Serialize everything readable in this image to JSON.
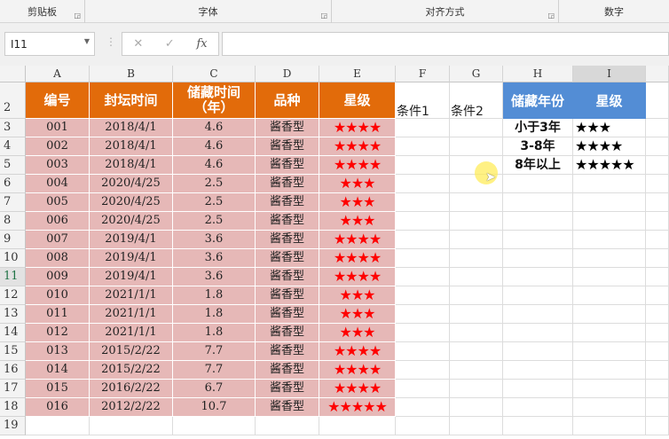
{
  "ribbon": {
    "groups": [
      "剪贴板",
      "字体",
      "对齐方式",
      "数字"
    ]
  },
  "formula_bar": {
    "name_box": "I11",
    "cancel": "✕",
    "enter": "✓",
    "fx": "fx",
    "value": ""
  },
  "columns": [
    "A",
    "B",
    "C",
    "D",
    "E",
    "F",
    "G",
    "H",
    "I"
  ],
  "rows": [
    "2",
    "3",
    "4",
    "5",
    "6",
    "7",
    "8",
    "9",
    "10",
    "11",
    "12",
    "13",
    "14",
    "15",
    "16",
    "17",
    "18",
    "19"
  ],
  "selected_row": "11",
  "headers": {
    "a": "编号",
    "b": "封坛时间",
    "c": "储藏时间",
    "c2": "（年）",
    "d": "品种",
    "e": "星级",
    "f": "条件1",
    "g": "条件2",
    "h": "储藏年份",
    "i": "星级"
  },
  "table": [
    [
      "001",
      "2018/4/1",
      "4.6",
      "酱香型",
      "★★★★"
    ],
    [
      "002",
      "2018/4/1",
      "4.6",
      "酱香型",
      "★★★★"
    ],
    [
      "003",
      "2018/4/1",
      "4.6",
      "酱香型",
      "★★★★"
    ],
    [
      "004",
      "2020/4/25",
      "2.5",
      "酱香型",
      "★★★"
    ],
    [
      "005",
      "2020/4/25",
      "2.5",
      "酱香型",
      "★★★"
    ],
    [
      "006",
      "2020/4/25",
      "2.5",
      "酱香型",
      "★★★"
    ],
    [
      "007",
      "2019/4/1",
      "3.6",
      "酱香型",
      "★★★★"
    ],
    [
      "008",
      "2019/4/1",
      "3.6",
      "酱香型",
      "★★★★"
    ],
    [
      "009",
      "2019/4/1",
      "3.6",
      "酱香型",
      "★★★★"
    ],
    [
      "010",
      "2021/1/1",
      "1.8",
      "酱香型",
      "★★★"
    ],
    [
      "011",
      "2021/1/1",
      "1.8",
      "酱香型",
      "★★★"
    ],
    [
      "012",
      "2021/1/1",
      "1.8",
      "酱香型",
      "★★★"
    ],
    [
      "013",
      "2015/2/22",
      "7.7",
      "酱香型",
      "★★★★"
    ],
    [
      "014",
      "2015/2/22",
      "7.7",
      "酱香型",
      "★★★★"
    ],
    [
      "015",
      "2016/2/22",
      "6.7",
      "酱香型",
      "★★★★"
    ],
    [
      "016",
      "2012/2/22",
      "10.7",
      "酱香型",
      "★★★★★"
    ]
  ],
  "lookup": [
    [
      "小于3年",
      "★★★"
    ],
    [
      "3-8年",
      "★★★★"
    ],
    [
      "8年以上",
      "★★★★★"
    ]
  ]
}
